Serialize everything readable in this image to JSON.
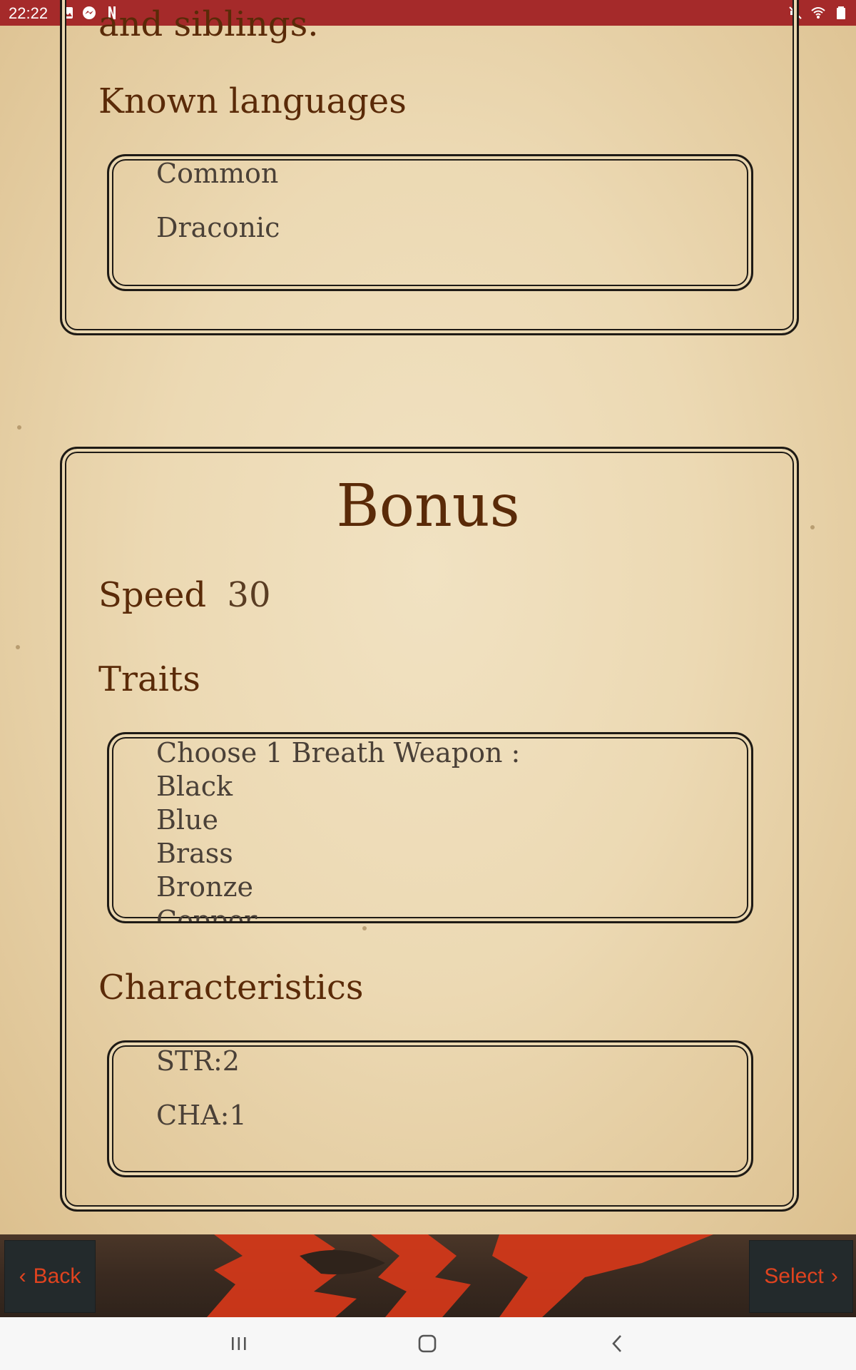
{
  "status_bar": {
    "time": "22:22",
    "left_icons": [
      "image-icon",
      "messenger-icon",
      "netflix-icon"
    ],
    "right_icons": [
      "mute-icon",
      "wifi-icon",
      "battery-icon"
    ]
  },
  "top_card": {
    "clipped_text": "and siblings.",
    "heading": "Known languages",
    "languages": [
      "Common",
      "Draconic"
    ]
  },
  "bonus_card": {
    "title": "Bonus",
    "speed_label": "Speed",
    "speed_value": "30",
    "traits_heading": "Traits",
    "traits_lines": [
      "Choose 1 Breath Weapon :",
      "Black",
      "Blue",
      "Brass",
      "Bronze",
      "Copper"
    ],
    "characteristics_heading": "Characteristics",
    "characteristics": [
      "STR:2",
      "CHA:1"
    ]
  },
  "bottom_bar": {
    "back_label": "Back",
    "select_label": "Select"
  },
  "colors": {
    "status_bar_bg": "#a52a2a",
    "heading": "#5a2a08",
    "button_text": "#e0431f",
    "emblem": "#d8381a"
  }
}
